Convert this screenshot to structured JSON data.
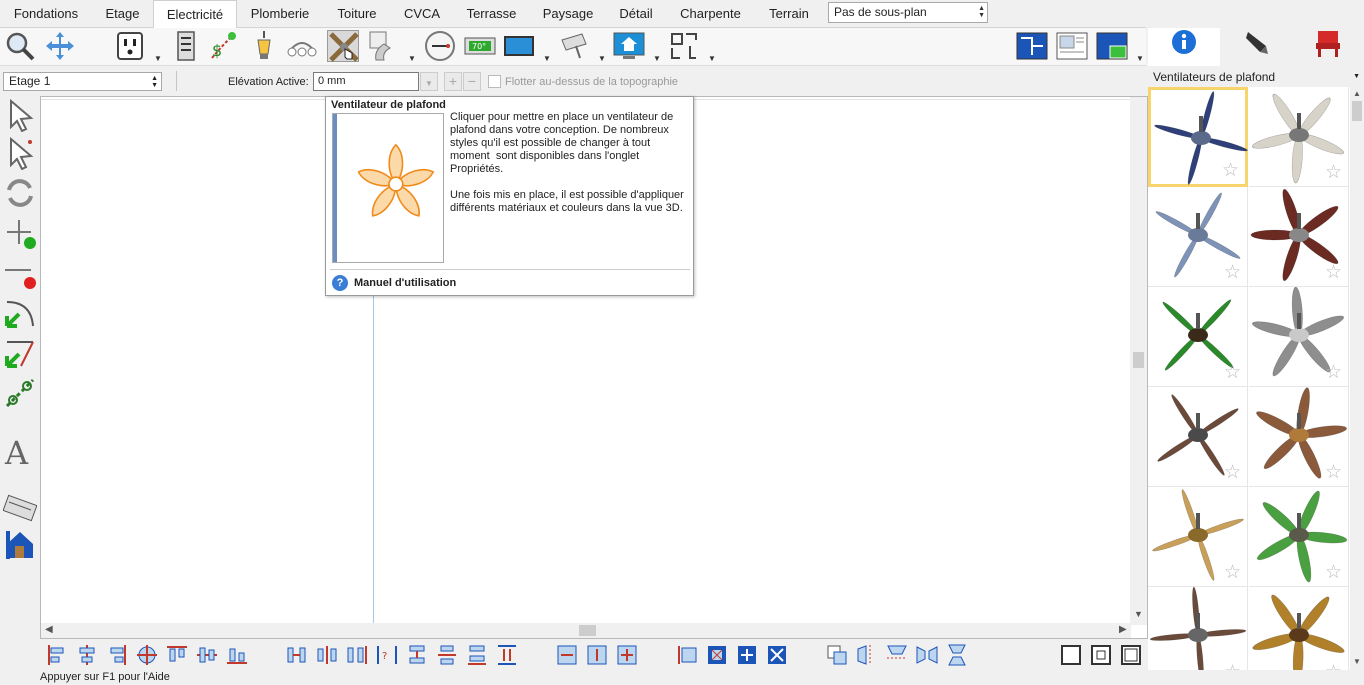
{
  "tabs": [
    {
      "label": "Fondations",
      "active": false
    },
    {
      "label": "Etage",
      "active": false
    },
    {
      "label": "Electricité",
      "active": true
    },
    {
      "label": "Plomberie",
      "active": false
    },
    {
      "label": "Toiture",
      "active": false
    },
    {
      "label": "CVCA",
      "active": false
    },
    {
      "label": "Terrasse",
      "active": false
    },
    {
      "label": "Paysage",
      "active": false
    },
    {
      "label": "Détail",
      "active": false
    },
    {
      "label": "Charpente",
      "active": false
    },
    {
      "label": "Terrain",
      "active": false
    }
  ],
  "subplan": {
    "value": "Pas de sous-plan"
  },
  "options": {
    "floor": "Etage 1",
    "elevation_label": "Elévation Active:",
    "elevation_value": "0 mm",
    "float_label": "Flotter au-dessus de la topographie"
  },
  "tooltip": {
    "title": "Ventilateur de plafond",
    "body": "Cliquer pour mettre en place un ventilateur de plafond dans votre conception. De nombreux styles qu'il est possible de changer à tout moment  sont disponibles dans l'onglet Propriétés.\n\nUne fois mis en place, il est possible d'appliquer différents matériaux et couleurs dans la vue 3D.",
    "help": "Manuel d'utilisation"
  },
  "library": {
    "category": "Ventilateurs de plafond",
    "items": [
      {
        "name": "fan-1",
        "blade": "#2e3f7a",
        "hub": "#5a6a8a",
        "selected": true
      },
      {
        "name": "fan-2",
        "blade": "#d8d3c8",
        "hub": "#777777",
        "selected": false
      },
      {
        "name": "fan-3",
        "blade": "#7d93b8",
        "hub": "#6a7a99",
        "selected": false
      },
      {
        "name": "fan-4",
        "blade": "#6b2a22",
        "hub": "#888888",
        "selected": false
      },
      {
        "name": "fan-5",
        "blade": "#2a8a2a",
        "hub": "#3a2a1a",
        "selected": false
      },
      {
        "name": "fan-6",
        "blade": "#8e8e8e",
        "hub": "#c9c9c9",
        "selected": false
      },
      {
        "name": "fan-7",
        "blade": "#6b4a3a",
        "hub": "#4a4a4a",
        "selected": false
      },
      {
        "name": "fan-8",
        "blade": "#8a5a3a",
        "hub": "#b07a3a",
        "selected": false
      },
      {
        "name": "fan-9",
        "blade": "#c9a05a",
        "hub": "#8a6a2a",
        "selected": false
      },
      {
        "name": "fan-10",
        "blade": "#4aa040",
        "hub": "#5a5a4a",
        "selected": false
      },
      {
        "name": "fan-11",
        "blade": "#6a4a3a",
        "hub": "#666666",
        "selected": false
      },
      {
        "name": "fan-12",
        "blade": "#b0802a",
        "hub": "#5a3a1a",
        "selected": false
      }
    ]
  },
  "status": {
    "text": "Appuyer sur F1 pour l'Aide"
  },
  "colors": {
    "accent_blue": "#1c6fd6",
    "tooltip_art": "#f08a1a",
    "selection": "#f7d56c"
  }
}
